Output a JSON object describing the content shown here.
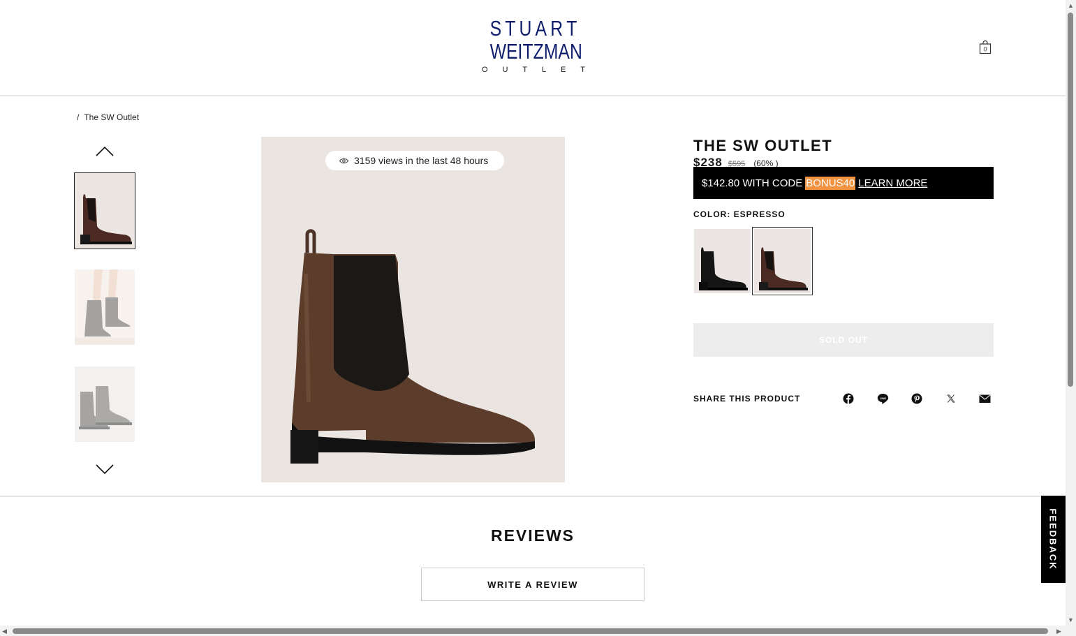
{
  "brand": {
    "line1": [
      "S",
      "T",
      "U",
      "A",
      "R",
      "T"
    ],
    "line2": [
      "W",
      "E",
      "I",
      "T",
      "Z",
      "M",
      "A",
      "N"
    ],
    "line3": [
      "O",
      "U",
      "T",
      "L",
      "E",
      "T"
    ],
    "color": "#0f1f6e"
  },
  "header": {
    "cart_count": "0"
  },
  "breadcrumb": {
    "separator": "/",
    "current": "The SW Outlet"
  },
  "gallery": {
    "views_text": "3159 views in the last 48 hours",
    "thumbnails": [
      "thumb-boot-side",
      "thumb-boot-model",
      "thumb-boot-pair"
    ]
  },
  "product": {
    "title": "THE SW OUTLET",
    "price": "$238",
    "original_price": "$595",
    "discount": "(60% )",
    "promo": {
      "text": "$142.80 WITH CODE",
      "code": "BONUS40",
      "link": "LEARN MORE",
      "code_color": "#f29341"
    },
    "color_label": "COLOR:",
    "color_value": "ESPRESSO",
    "swatches": [
      "black",
      "espresso"
    ],
    "sold_out_label": "SOLD OUT",
    "share_label": "SHARE THIS PRODUCT",
    "share_icons": [
      "facebook-icon",
      "line-icon",
      "pinterest-icon",
      "x-icon",
      "email-icon"
    ]
  },
  "reviews": {
    "title": "REVIEWS",
    "write_label": "WRITE A REVIEW"
  },
  "feedback_label": "FEEDBACK"
}
